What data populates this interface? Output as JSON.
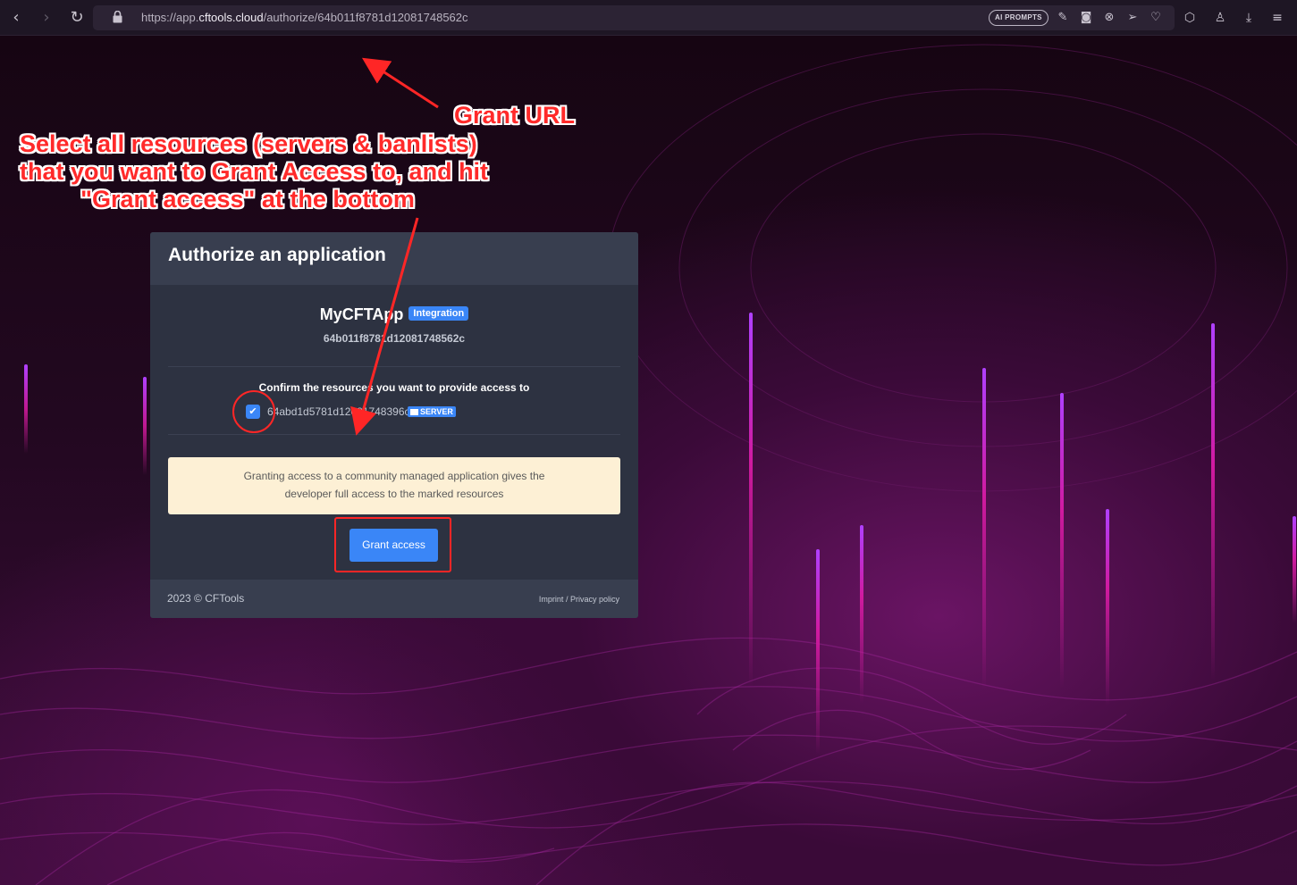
{
  "browser": {
    "url_prefix": "https://app.",
    "url_host": "cftools.cloud",
    "url_path": "/authorize/64b011f8781d12081748562c",
    "ai_badge": "AI PROMPTS"
  },
  "annotations": {
    "grant_url": "Grant URL",
    "instructions_line1": "Select all resources (servers & banlists)",
    "instructions_line2": "that you want to Grant Access to, and hit",
    "instructions_line3": "\"Grant access\" at the bottom"
  },
  "card": {
    "title": "Authorize an application",
    "app_name": "MyCFTApp",
    "app_badge": "Integration",
    "app_id": "64b011f8781d12081748562c",
    "confirm_label": "Confirm the resources you want to provide access to",
    "resources": [
      {
        "id": "64abd1d5781d12081748396c",
        "type": "SERVER",
        "checked": true
      }
    ],
    "warning": "Granting access to a community managed application gives the developer full access to the marked resources",
    "grant_button": "Grant access",
    "footer_copyright": "2023 © CFTools",
    "footer_imprint": "Imprint",
    "footer_sep": "/",
    "footer_privacy": "Privacy policy"
  },
  "colors": {
    "accent": "#3a86f7",
    "annotation": "#ff2a2a",
    "warning_bg": "#fdf0d5"
  }
}
